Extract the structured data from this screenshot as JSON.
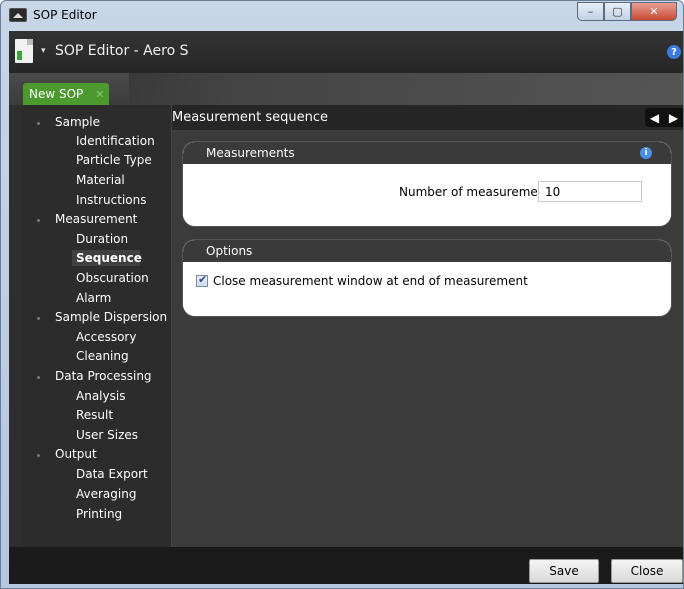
{
  "window": {
    "title": "SOP Editor",
    "min_glyph": "–",
    "max_glyph": "▢",
    "close_glyph": "✕"
  },
  "header": {
    "caret": "▾",
    "app_title": "SOP Editor - Aero S",
    "help_glyph": "?"
  },
  "tabs": [
    {
      "label": "New SOP",
      "close_glyph": "✕"
    }
  ],
  "sidebar": {
    "groups": [
      {
        "label": "Sample",
        "items": [
          "Identification",
          "Particle Type",
          "Material",
          "Instructions"
        ]
      },
      {
        "label": "Measurement",
        "items": [
          "Duration",
          "Sequence",
          "Obscuration",
          "Alarm"
        ]
      },
      {
        "label": "Sample Dispersion",
        "items": [
          "Accessory",
          "Cleaning"
        ]
      },
      {
        "label": "Data Processing",
        "items": [
          "Analysis",
          "Result",
          "User Sizes"
        ]
      },
      {
        "label": "Output",
        "items": [
          "Data Export",
          "Averaging",
          "Printing"
        ]
      }
    ],
    "selected": "Sequence"
  },
  "panel": {
    "title": "Measurement sequence",
    "prev_glyph": "◀",
    "next_glyph": "▶",
    "measurements": {
      "header": "Measurements",
      "info_glyph": "i",
      "field_label": "Number of measurements:",
      "field_value": "10"
    },
    "options": {
      "header": "Options",
      "checkbox_label": "Close measurement window at end of measurement",
      "checked": true
    }
  },
  "footer": {
    "save_label": "Save",
    "close_label": "Close"
  }
}
